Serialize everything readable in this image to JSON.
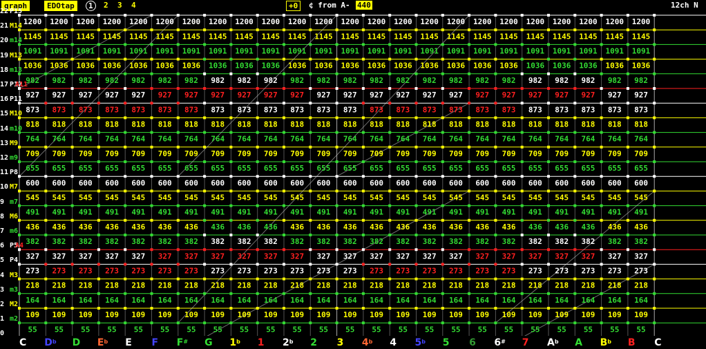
{
  "toolbar": {
    "graph_label": "graph",
    "edo_tap_label": "EDOtap",
    "tabs": [
      "1",
      "2",
      "3",
      "4"
    ],
    "active_tab": "1",
    "offset_value": "+0",
    "cents_from_label": "¢ from A-",
    "reference_freq": "440",
    "channel_label": "12ch N"
  },
  "colors": {
    "white": "#ffffff",
    "yellow": "#ffff00",
    "green": "#33dd33",
    "red": "#ff2020",
    "blue": "#4444ff",
    "orange": "#ff6633",
    "darkgreen": "#339933",
    "gridline": "#777777"
  },
  "interval_rows": [
    {
      "step": "22",
      "name": "P15",
      "cents": "1200",
      "color": "white"
    },
    {
      "step": "21",
      "name": "M14",
      "cents": "1145",
      "color": "yellow"
    },
    {
      "step": "20",
      "name": "m14",
      "cents": "1091",
      "color": "green"
    },
    {
      "step": "19",
      "name": "M13",
      "cents": "1036",
      "color": "yellow"
    },
    {
      "step": "18",
      "name": "m13",
      "cents": "982",
      "color": "green"
    },
    {
      "step": "17",
      "name": "P12",
      "cents": "927",
      "color": "white",
      "overlay_name": "A11",
      "overlay_color": "red",
      "alt_cents": "927"
    },
    {
      "step": "16",
      "name": "P11",
      "cents": "873",
      "color": "white",
      "alt_color": "red"
    },
    {
      "step": "15",
      "name": "M10",
      "cents": "818",
      "color": "yellow"
    },
    {
      "step": "14",
      "name": "m10",
      "cents": "764",
      "color": "green"
    },
    {
      "step": "13",
      "name": "M9",
      "cents": "709",
      "color": "yellow"
    },
    {
      "step": "12",
      "name": "m9",
      "cents": "655",
      "color": "green"
    },
    {
      "step": "11",
      "name": "P8",
      "cents": "600",
      "color": "white"
    },
    {
      "step": "10",
      "name": "M7",
      "cents": "545",
      "color": "yellow"
    },
    {
      "step": "9",
      "name": "m7",
      "cents": "491",
      "color": "green"
    },
    {
      "step": "8",
      "name": "M6",
      "cents": "436",
      "color": "yellow"
    },
    {
      "step": "7",
      "name": "m6",
      "cents": "382",
      "color": "green"
    },
    {
      "step": "6",
      "name": "P5",
      "cents": "327",
      "color": "white",
      "overlay_name": "A4",
      "overlay_color": "red"
    },
    {
      "step": "5",
      "name": "P4",
      "cents": "273",
      "color": "white",
      "alt_color": "red"
    },
    {
      "step": "4",
      "name": "M3",
      "cents": "218",
      "color": "yellow"
    },
    {
      "step": "3",
      "name": "m3",
      "cents": "164",
      "color": "green"
    },
    {
      "step": "2",
      "name": "M2",
      "cents": "109",
      "color": "yellow"
    },
    {
      "step": "1",
      "name": "m2",
      "cents": "55",
      "color": "green"
    },
    {
      "step": "0",
      "name": "",
      "cents": "",
      "color": "white"
    }
  ],
  "note_names": [
    {
      "name": "C",
      "acc": "",
      "color": "white"
    },
    {
      "name": "D",
      "acc": "b",
      "color": "blue"
    },
    {
      "name": "D",
      "acc": "",
      "color": "green"
    },
    {
      "name": "E",
      "acc": "b",
      "color": "orange"
    },
    {
      "name": "E",
      "acc": "",
      "color": "white"
    },
    {
      "name": "F",
      "acc": "",
      "color": "blue"
    },
    {
      "name": "F",
      "acc": "#",
      "color": "green"
    },
    {
      "name": "G",
      "acc": "",
      "color": "green"
    },
    {
      "name": "1",
      "acc": "b",
      "color": "yellow"
    },
    {
      "name": "1",
      "acc": "",
      "color": "red"
    },
    {
      "name": "2",
      "acc": "b",
      "color": "white"
    },
    {
      "name": "2",
      "acc": "",
      "color": "green"
    },
    {
      "name": "3",
      "acc": "",
      "color": "yellow"
    },
    {
      "name": "4",
      "acc": "b",
      "color": "orange"
    },
    {
      "name": "4",
      "acc": "",
      "color": "white"
    },
    {
      "name": "5",
      "acc": "b",
      "color": "blue"
    },
    {
      "name": "5",
      "acc": "",
      "color": "green"
    },
    {
      "name": "6",
      "acc": "",
      "color": "darkgreen"
    },
    {
      "name": "6",
      "acc": "#",
      "color": "white"
    },
    {
      "name": "7",
      "acc": "",
      "color": "red"
    },
    {
      "name": "A",
      "acc": "b",
      "color": "white"
    },
    {
      "name": "A",
      "acc": "",
      "color": "green"
    },
    {
      "name": "B",
      "acc": "b",
      "color": "yellow"
    },
    {
      "name": "B",
      "acc": "",
      "color": "red"
    },
    {
      "name": "C",
      "acc": "",
      "color": "white"
    }
  ],
  "red_cells": {
    "17": [
      5,
      6,
      7,
      8,
      9,
      10,
      17,
      18,
      19,
      20,
      21
    ],
    "16": [
      1,
      2,
      3,
      4,
      5,
      6,
      13,
      14,
      15,
      16,
      17,
      18
    ],
    "6": [
      5,
      6,
      7,
      8,
      9,
      10,
      17,
      18,
      19,
      20,
      21
    ],
    "5": [
      1,
      2,
      3,
      4,
      5,
      6,
      13,
      14,
      15,
      16,
      17,
      18
    ]
  },
  "white_cells": {
    "18": [
      7,
      8,
      9,
      19,
      20,
      21
    ],
    "7": [
      7,
      8,
      9,
      19,
      20,
      21
    ]
  },
  "green_cells": {
    "19": [
      7,
      8,
      9,
      19,
      20,
      21
    ],
    "8": [
      7,
      8,
      9,
      19,
      20,
      21
    ]
  }
}
